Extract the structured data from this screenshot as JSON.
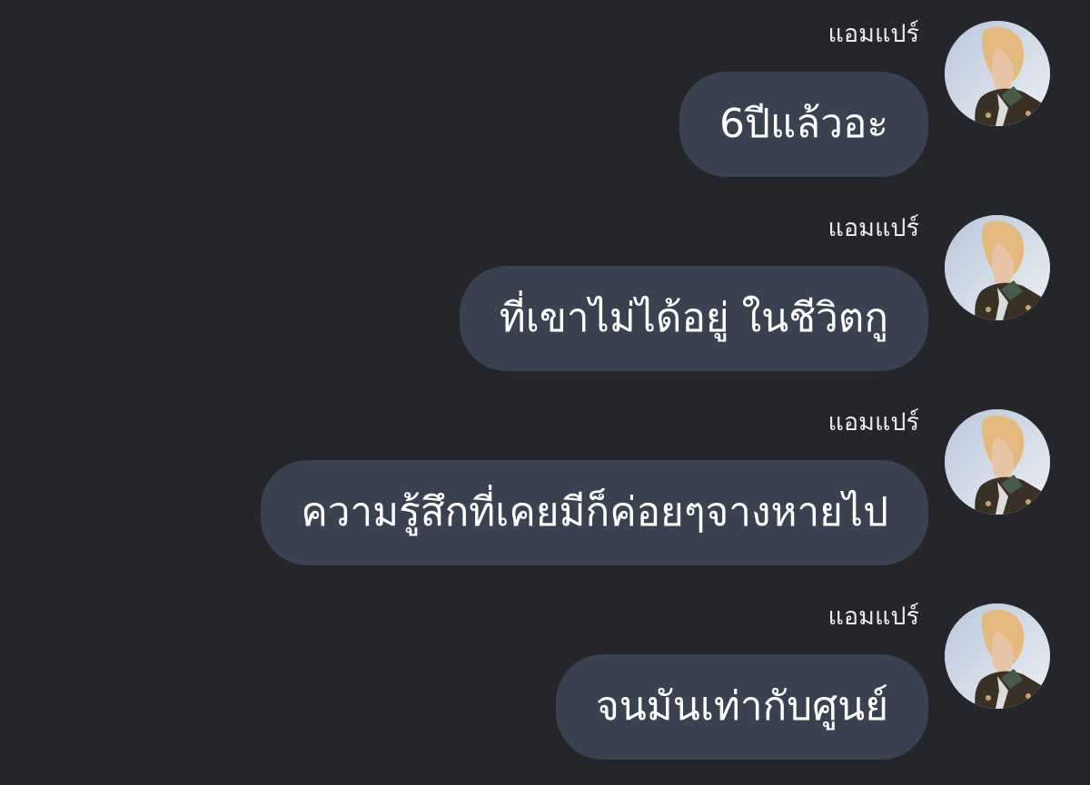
{
  "conversation": {
    "messages": [
      {
        "sender": "แอมแปร์",
        "text": "6ปีแล้วอะ"
      },
      {
        "sender": "แอมแปร์",
        "text": "ที่เขาไม่ได้อยู่ ในชีวิตกู"
      },
      {
        "sender": "แอมแปร์",
        "text": "ความรู้สึกที่เคยมีก็ค่อยๆจางหายไป"
      },
      {
        "sender": "แอมแปร์",
        "text": "จนมันเท่ากับศูนย์"
      }
    ]
  },
  "colors": {
    "background": "#25262c",
    "bubble": "#3a4150",
    "bubble_text": "#ffffff",
    "sender_text": "#e9e9ee"
  },
  "icons": {
    "avatar": "user-avatar-photo"
  }
}
